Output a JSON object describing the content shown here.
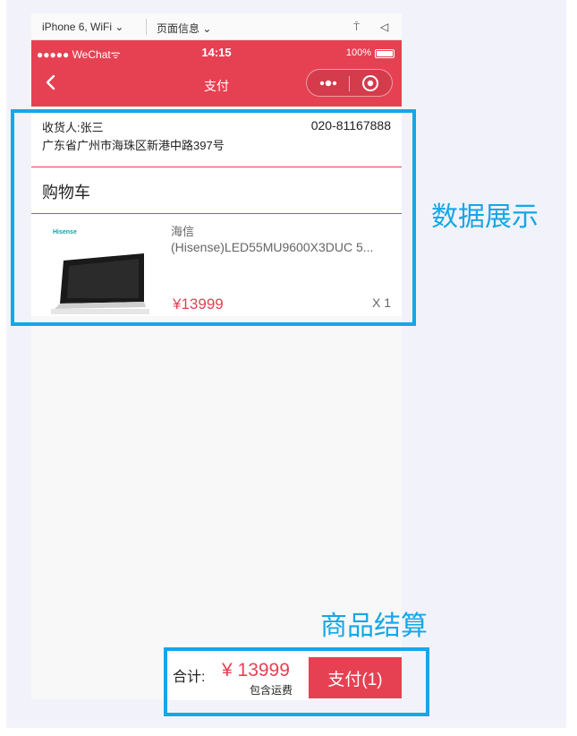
{
  "simulator": {
    "device": "iPhone 6, WiFi ⌄",
    "page_info": "页面信息 ⌄",
    "tool_a": "⍑",
    "tool_b": "◁"
  },
  "status_bar": {
    "carrier": "●●●●● WeChat",
    "wifi": "ᯤ",
    "time": "14:15",
    "battery": "100%"
  },
  "nav": {
    "title": "支付",
    "back_icon": "chevron-left",
    "menu_icon": "more-dots",
    "close_icon": "record-circle"
  },
  "address": {
    "receiver": "收货人:张三",
    "phone": "020-81167888",
    "detail": "广东省广州市海珠区新港中路397号"
  },
  "cart": {
    "title": "购物车",
    "items": [
      {
        "brand": "海信",
        "name": "(Hisense)LED55MU9600X3DUC 5...",
        "price": "¥13999",
        "quantity": "X 1",
        "logo_text": "Hisense"
      }
    ]
  },
  "annotations": {
    "data_display": "数据展示",
    "checkout": "商品结算"
  },
  "checkout": {
    "total_label": "合计:",
    "total_amount": "¥ 13999",
    "shipping_note": "包含运费",
    "pay_button": "支付(1)"
  },
  "colors": {
    "brand_red": "#e64152",
    "annotation_blue": "#15a7e6",
    "page_bg": "#f2f3fa"
  }
}
